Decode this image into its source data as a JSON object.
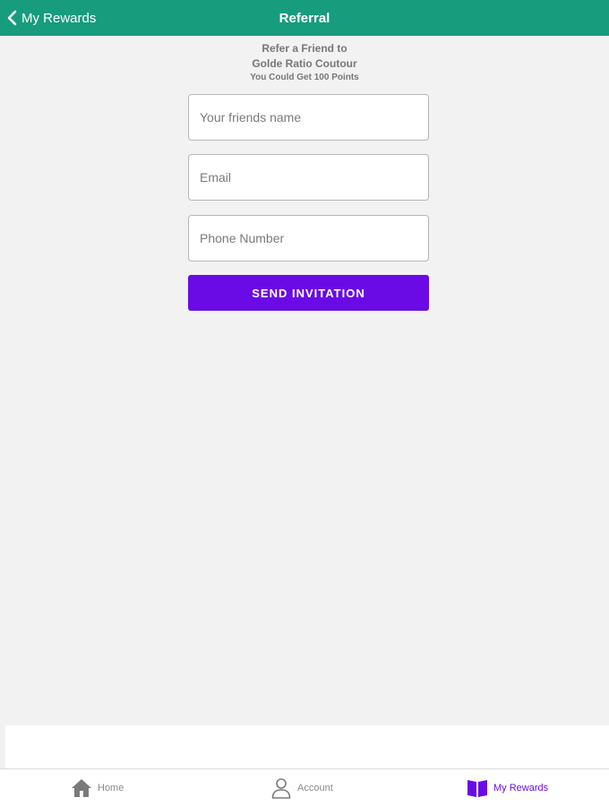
{
  "header": {
    "back_label": "My Rewards",
    "title": "Referral"
  },
  "intro": {
    "line1": "Refer a Friend to",
    "line2": "Golde Ratio Coutour",
    "line3": "You Could Get 100  Points"
  },
  "form": {
    "name_placeholder": "Your friends name",
    "email_placeholder": "Email",
    "phone_placeholder": "Phone Number",
    "name_value": "",
    "email_value": "",
    "phone_value": "",
    "submit_label": "SEND INVITATION"
  },
  "tabs": [
    {
      "label": "Home",
      "icon": "home-icon",
      "active": false
    },
    {
      "label": "Account",
      "icon": "person-icon",
      "active": false
    },
    {
      "label": "My Rewards",
      "icon": "book-icon",
      "active": true
    }
  ],
  "colors": {
    "header_bg": "#179c7d",
    "accent": "#6a0be6",
    "background": "#f2f2f2"
  }
}
